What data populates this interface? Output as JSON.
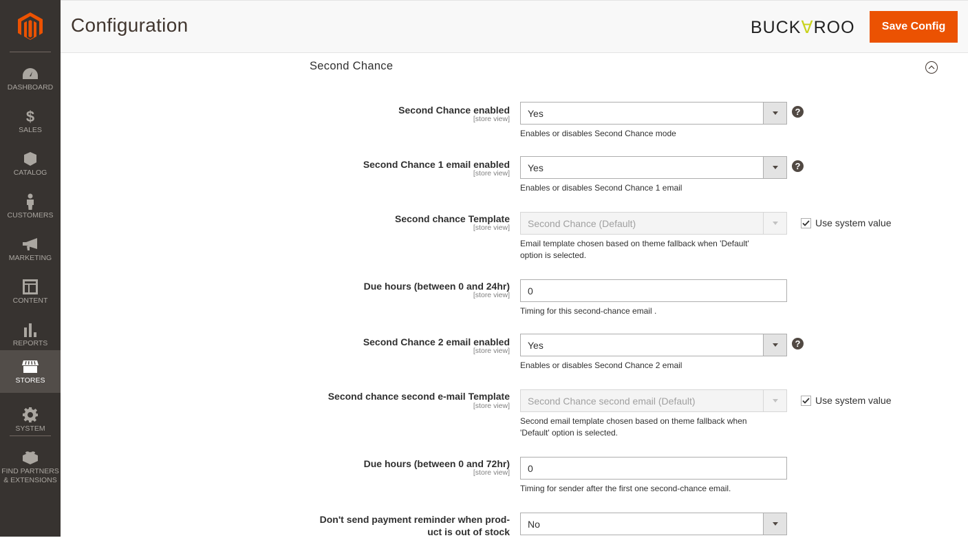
{
  "sidebar": {
    "items": [
      {
        "label": "DASHBOARD",
        "icon": "dashboard-icon"
      },
      {
        "label": "SALES",
        "icon": "dollar-icon"
      },
      {
        "label": "CATALOG",
        "icon": "box-icon"
      },
      {
        "label": "CUSTOMERS",
        "icon": "person-icon"
      },
      {
        "label": "MARKETING",
        "icon": "megaphone-icon"
      },
      {
        "label": "CONTENT",
        "icon": "layout-icon"
      },
      {
        "label": "REPORTS",
        "icon": "bar-chart-icon"
      },
      {
        "label": "STORES",
        "icon": "store-icon",
        "active": true
      },
      {
        "label": "SYSTEM",
        "icon": "gear-icon"
      },
      {
        "label": "FIND PARTNERS & EXTENSIONS",
        "icon": "lego-brick-icon"
      }
    ]
  },
  "header": {
    "title": "Configuration",
    "brand": {
      "pre": "BUCK",
      "mid": "∀",
      "post": "ROO"
    },
    "save_label": "Save Config"
  },
  "colors": {
    "accent": "#eb5202",
    "sidebar": "#373330",
    "brand_accent": "#c8d21c"
  },
  "section": {
    "title": "Second Chance",
    "fields": [
      {
        "label": "Second Chance enabled",
        "scope": "[store view]",
        "type": "select",
        "value": "Yes",
        "note": "Enables or disables Second Chance mode",
        "help": true
      },
      {
        "label": "Second Chance 1 email enabled",
        "scope": "[store view]",
        "type": "select",
        "value": "Yes",
        "note": "Enables or disables Second Chance 1 email",
        "help": true
      },
      {
        "label": "Second chance Template",
        "scope": "[store view]",
        "type": "select",
        "disabled": true,
        "value": "Second Chance (Default)",
        "note": "Email template chosen based on theme fallback when 'Default' option is selected.",
        "use_system_value": "Use system value"
      },
      {
        "label": "Due hours (between 0 and 24hr)",
        "scope": "[store view]",
        "type": "text",
        "value": "0",
        "note": "Timing for this second-chance email ."
      },
      {
        "label": "Second Chance 2 email enabled",
        "scope": "[store view]",
        "type": "select",
        "value": "Yes",
        "note": "Enables or disables Second Chance 2 email",
        "help": true
      },
      {
        "label": "Second chance second e-mail Template",
        "scope": "[store view]",
        "type": "select",
        "disabled": true,
        "value": "Second Chance second email (Default)",
        "note": "Second email template chosen based on theme fallback when 'Default' option is selected.",
        "use_system_value": "Use system value"
      },
      {
        "label": "Due hours (between 0 and 72hr)",
        "scope": "[store view]",
        "type": "text",
        "value": "0",
        "note": "Timing for sender after the first one second-chance email."
      },
      {
        "label": "Don't send payment reminder when prod-uct is out of stock",
        "type": "select",
        "value": "No"
      }
    ]
  },
  "help_glyph": "?"
}
